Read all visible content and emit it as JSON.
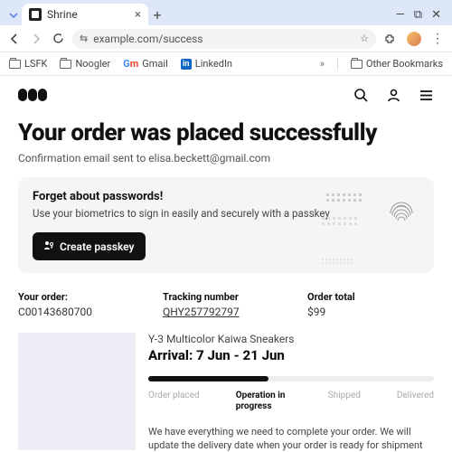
{
  "browser": {
    "tab_title": "Shrine",
    "url": "example.com/success",
    "bookmarks": {
      "lsfk": "LSFK",
      "noogler": "Noogler",
      "gmail": "Gmail",
      "linkedin": "LinkedIn",
      "other": "Other Bookmarks"
    }
  },
  "page": {
    "heading": "Your order was placed successfully",
    "confirmation": "Confirmation email sent to elisa.beckett@gmail.com"
  },
  "passkey": {
    "title": "Forget about passwords!",
    "subtitle": "Use your biometrics to sign in easily and securely with a passkey",
    "button": "Create passkey"
  },
  "order": {
    "your_order_label": "Your order:",
    "order_number": "C00143680700",
    "tracking_label": "Tracking number",
    "tracking_number": "QHY257792797",
    "total_label": "Order total",
    "total_value": "$99"
  },
  "product": {
    "name": "Y-3 Multicolor Kaiwa Sneakers",
    "arrival": "Arrival: 7 Jun - 21 Jun",
    "stages": {
      "placed": "Order placed",
      "operation": "Operation in progress",
      "shipped": "Shipped",
      "delivered": "Delivered"
    },
    "note": "We have everything we need to complete your order. We will update the delivery date when your order is ready for shipment"
  }
}
